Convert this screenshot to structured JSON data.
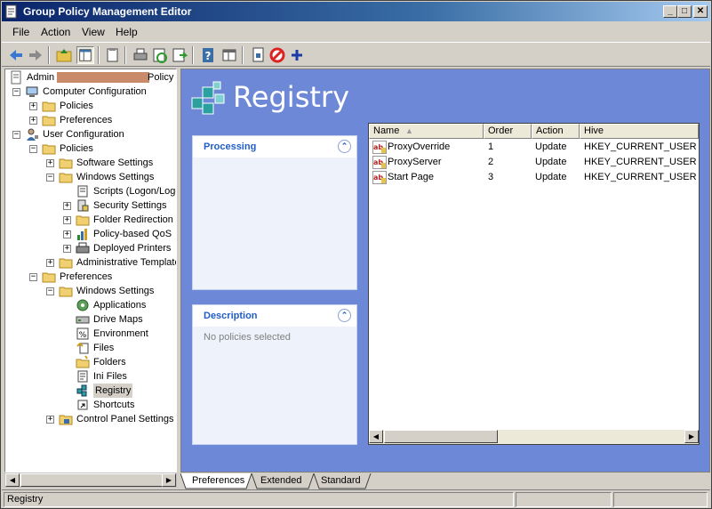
{
  "window": {
    "title": "Group Policy Management Editor",
    "minimize": "_",
    "maximize": "□",
    "close": "✕"
  },
  "menu": {
    "file": "File",
    "action": "Action",
    "view": "View",
    "help": "Help"
  },
  "toolbar": {
    "icons": [
      "back-arrow-icon",
      "forward-arrow-icon",
      "up-folder-icon",
      "show-hide-tree-icon",
      "properties-icon",
      "print-icon",
      "refresh-icon",
      "export-icon",
      "help-icon",
      "console-icon",
      "new-document-icon",
      "stop-icon",
      "add-icon"
    ]
  },
  "tree": {
    "root": {
      "label_start": "Admin",
      "label_end": "Policy"
    },
    "items": [
      {
        "label": "Computer Configuration"
      },
      {
        "label": "Policies"
      },
      {
        "label": "Preferences"
      },
      {
        "label": "User Configuration"
      },
      {
        "label": "Policies"
      },
      {
        "label": "Software Settings"
      },
      {
        "label": "Windows Settings"
      },
      {
        "label": "Scripts (Logon/Logoff)"
      },
      {
        "label": "Security Settings"
      },
      {
        "label": "Folder Redirection"
      },
      {
        "label": "Policy-based QoS"
      },
      {
        "label": "Deployed Printers"
      },
      {
        "label": "Administrative Templates"
      },
      {
        "label": "Preferences"
      },
      {
        "label": "Windows Settings"
      },
      {
        "label": "Applications"
      },
      {
        "label": "Drive Maps"
      },
      {
        "label": "Environment"
      },
      {
        "label": "Files"
      },
      {
        "label": "Folders"
      },
      {
        "label": "Ini Files"
      },
      {
        "label": "Registry"
      },
      {
        "label": "Shortcuts"
      },
      {
        "label": "Control Panel Settings"
      }
    ]
  },
  "main": {
    "heading": "Registry",
    "processing": {
      "title": "Processing"
    },
    "description": {
      "title": "Description",
      "body": "No policies selected"
    },
    "columns": {
      "name": "Name",
      "order": "Order",
      "action": "Action",
      "hive": "Hive"
    },
    "rows": [
      {
        "name": "ProxyOverride",
        "order": "1",
        "action": "Update",
        "hive": "HKEY_CURRENT_USER"
      },
      {
        "name": "ProxyServer",
        "order": "2",
        "action": "Update",
        "hive": "HKEY_CURRENT_USER"
      },
      {
        "name": "Start Page",
        "order": "3",
        "action": "Update",
        "hive": "HKEY_CURRENT_USER"
      }
    ]
  },
  "tabs": {
    "preferences": "Preferences",
    "extended": "Extended",
    "standard": "Standard"
  },
  "statusbar": {
    "text": "Registry"
  },
  "colors": {
    "accent": "#6d88d6",
    "title_text": "#215dc6",
    "redacted": "#c98a6a"
  }
}
